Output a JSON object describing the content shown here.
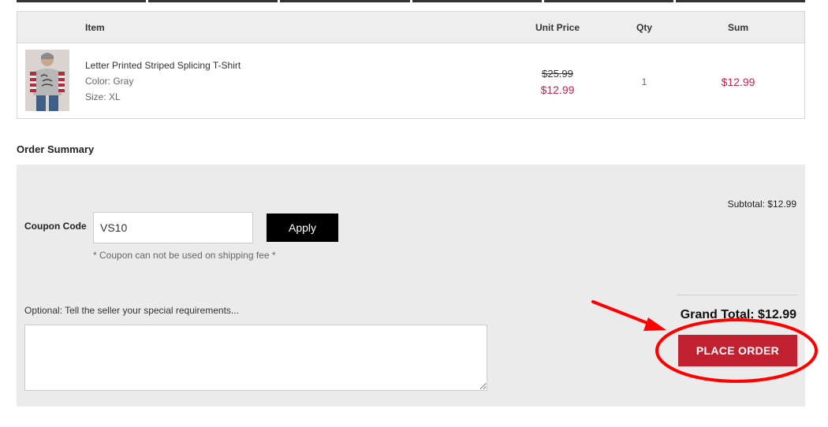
{
  "cart": {
    "headers": {
      "item": "Item",
      "unit_price": "Unit Price",
      "qty": "Qty",
      "sum": "Sum"
    },
    "items": [
      {
        "image_icon": "product-thumbnail",
        "name": "Letter Printed Striped Splicing T-Shirt",
        "color": "Color: Gray",
        "size": "Size: XL",
        "original_price": "$25.99",
        "price": "$12.99",
        "qty": "1",
        "sum": "$12.99"
      }
    ]
  },
  "summary": {
    "title": "Order Summary",
    "coupon_label": "Coupon Code",
    "coupon_value": "VS10",
    "apply_label": "Apply",
    "coupon_note": "* Coupon can not be used on shipping fee *",
    "requirements_label": "Optional: Tell the seller your special requirements...",
    "requirements_value": "",
    "subtotal": "Subtotal: $12.99",
    "grand_total": "Grand Total: $12.99",
    "place_order_label": "PLACE ORDER"
  },
  "colors": {
    "price_accent": "#c0264b",
    "place_order_bg": "#c02030",
    "annotation": "#ff0000",
    "apply_bg": "#000000"
  }
}
